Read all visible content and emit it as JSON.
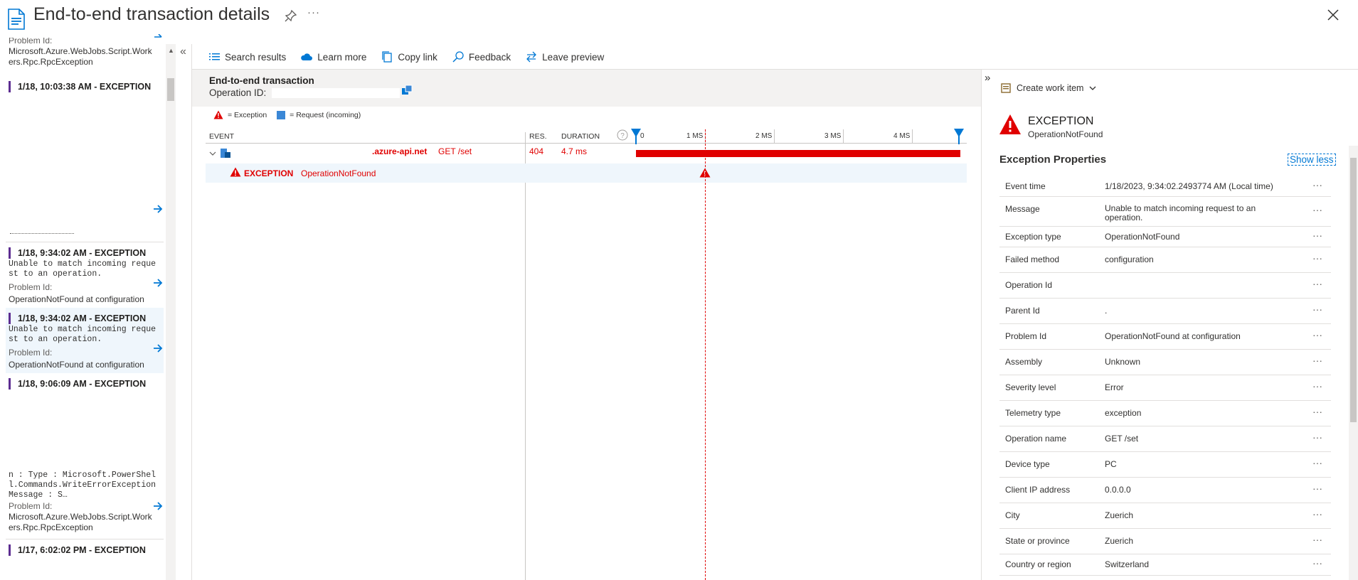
{
  "header": {
    "title": "End-to-end transaction details",
    "pin_icon": "pin-icon",
    "more_label": "···",
    "close_icon": "close-icon"
  },
  "left_list": {
    "partial_top": {
      "problem_label": "Problem Id:",
      "problem_value": "Microsoft.Azure.WebJobs.Script.Workers.Rpc.RpcException"
    },
    "items": [
      {
        "heading": "1/18, 10:03:38 AM - EXCEPTION"
      },
      {
        "heading": "1/18, 9:34:02 AM - EXCEPTION",
        "message": "Unable to match incoming request to an operation.",
        "problem_label": "Problem Id:",
        "problem_value": "OperationNotFound at configuration"
      },
      {
        "heading": "1/18, 9:34:02 AM - EXCEPTION",
        "message": "Unable to match incoming request to an operation.",
        "problem_label": "Problem Id:",
        "problem_value": "OperationNotFound at configuration",
        "selected": true
      },
      {
        "heading": "1/18, 9:06:09 AM - EXCEPTION",
        "message": "n : Type : Microsoft.PowerShell.Commands.WriteErrorException Message : S…",
        "problem_label": "Problem Id:",
        "problem_value": "Microsoft.Azure.WebJobs.Script.Workers.Rpc.RpcException"
      },
      {
        "heading": "1/17, 6:02:02 PM - EXCEPTION"
      }
    ],
    "collapse_label": "«"
  },
  "toolbar": {
    "search_results": "Search results",
    "learn_more": "Learn more",
    "copy_link": "Copy link",
    "feedback": "Feedback",
    "leave_preview": "Leave preview"
  },
  "transaction": {
    "title": "End-to-end transaction",
    "operation_id_label": "Operation ID:",
    "legend": {
      "exception": "= Exception",
      "request": "= Request (incoming)"
    },
    "columns": {
      "event": "EVENT",
      "res": "RES.",
      "duration": "DURATION"
    },
    "axis_labels": [
      "0",
      "1 MS",
      "2 MS",
      "3 MS",
      "4 MS"
    ],
    "rows": [
      {
        "host": ".azure-api.net",
        "method": "GET /set",
        "res": "404",
        "duration": "4.7 ms",
        "duration_ms": 4.7
      },
      {
        "type": "EXCEPTION",
        "name": "OperationNotFound",
        "at_ms": 1.0
      }
    ],
    "colors": {
      "error_red": "#e00000",
      "request_blue": "#3a87d6"
    }
  },
  "detail_panel": {
    "expand_label": "»",
    "work_item": "Create work item",
    "exception_title": "EXCEPTION",
    "exception_subtitle": "OperationNotFound",
    "section_title": "Exception Properties",
    "show_less": "Show less",
    "properties": [
      {
        "key": "Event time",
        "value": "1/18/2023, 9:34:02.2493774 AM (Local time)"
      },
      {
        "key": "Message",
        "value": "Unable to match incoming request to an operation."
      },
      {
        "key": "Exception type",
        "value": "OperationNotFound"
      },
      {
        "key": "Failed method",
        "value": "configuration"
      },
      {
        "key": "Operation Id",
        "value": ""
      },
      {
        "key": "Parent Id",
        "value": "."
      },
      {
        "key": "Problem Id",
        "value": "OperationNotFound at configuration"
      },
      {
        "key": "Assembly",
        "value": "Unknown"
      },
      {
        "key": "Severity level",
        "value": "Error"
      },
      {
        "key": "Telemetry type",
        "value": "exception"
      },
      {
        "key": "Operation name",
        "value": "GET /set"
      },
      {
        "key": "Device type",
        "value": "PC"
      },
      {
        "key": "Client IP address",
        "value": "0.0.0.0"
      },
      {
        "key": "City",
        "value": "Zuerich"
      },
      {
        "key": "State or province",
        "value": "Zuerich"
      },
      {
        "key": "Country or region",
        "value": "Switzerland"
      }
    ],
    "row_menu": "···"
  }
}
